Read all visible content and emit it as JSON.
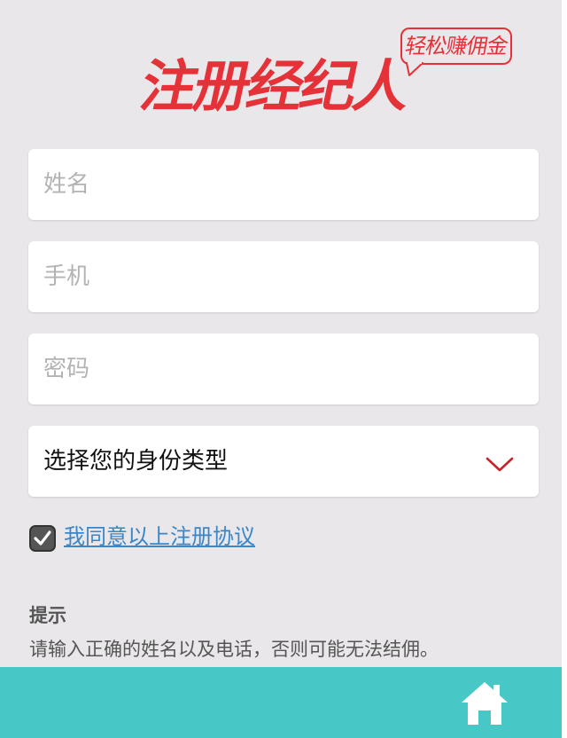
{
  "logo": {
    "title": "注册经纪人",
    "badge": "轻松赚佣金"
  },
  "form": {
    "name_placeholder": "姓名",
    "phone_placeholder": "手机",
    "password_placeholder": "密码",
    "role_select": {
      "label": "选择您的身份类型",
      "icon": "chevron-down-icon"
    }
  },
  "agreement": {
    "checked": true,
    "link_text": "我同意以上注册协议"
  },
  "tip": {
    "title": "提示",
    "text": "请输入正确的姓名以及电话，否则可能无法结佣。"
  },
  "bottom_bar": {
    "icon": "home-icon"
  },
  "colors": {
    "background": "#e9e7e9",
    "brand_red": "#e53238",
    "link_blue": "#3a86c8",
    "bottom_bar": "#47c7c5"
  }
}
